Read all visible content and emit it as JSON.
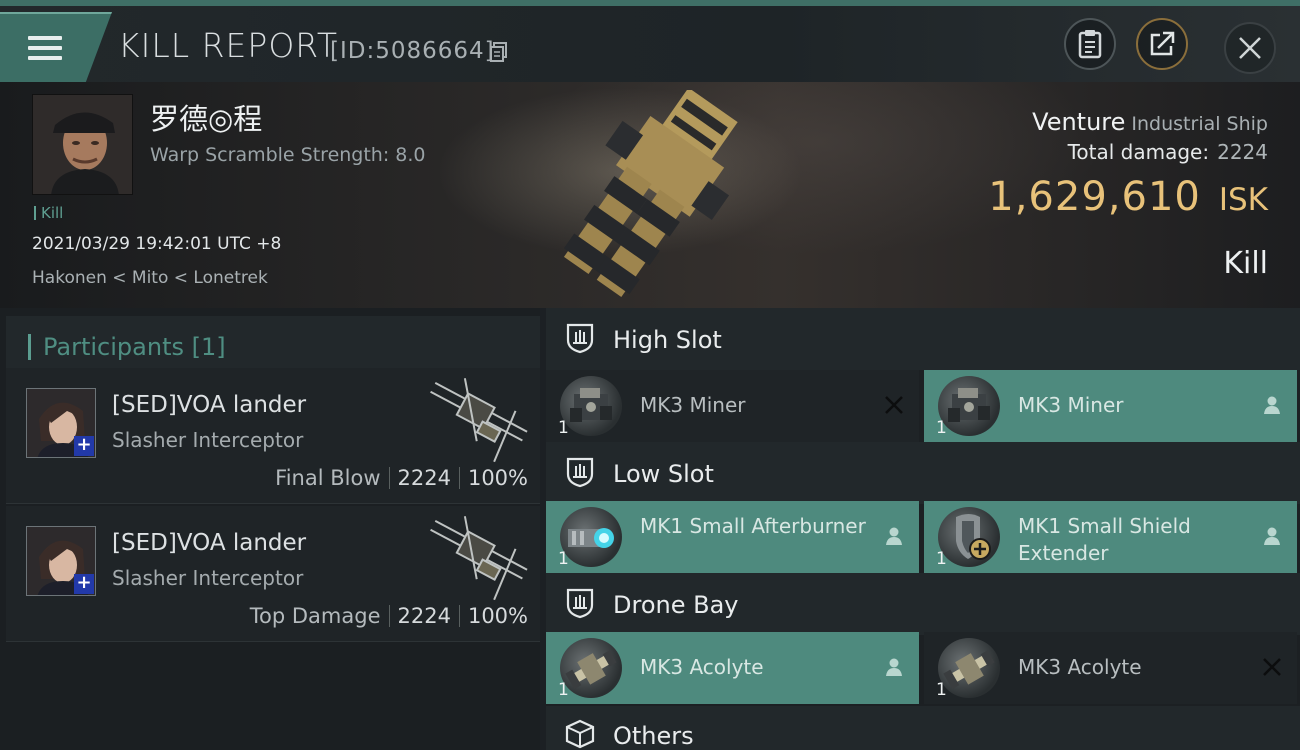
{
  "header": {
    "title": "KILL REPORT",
    "id_label": "[ID:5086664]"
  },
  "victim": {
    "name": "罗德◎程",
    "warp_scramble": "Warp Scramble Strength: 8.0",
    "tag": "Kill",
    "timestamp": "2021/03/29 19:42:01 UTC +8",
    "location": "Hakonen < Mito < Lonetrek"
  },
  "ship": {
    "name": "Venture",
    "class": "Industrial Ship",
    "total_damage_label": "Total damage:",
    "total_damage": "2224",
    "isk_value": "1,629,610",
    "isk_unit": "ISK",
    "result": "Kill"
  },
  "participants": {
    "title": "Participants [1]",
    "list": [
      {
        "name": "[SED]VOA lander",
        "ship": "Slasher Interceptor",
        "role": "Final Blow",
        "damage": "2224",
        "percent": "100%"
      },
      {
        "name": "[SED]VOA lander",
        "ship": "Slasher Interceptor",
        "role": "Top Damage",
        "damage": "2224",
        "percent": "100%"
      }
    ]
  },
  "fittings": {
    "high_slot": {
      "label": "High Slot",
      "modules": [
        {
          "name": "MK3 Miner",
          "qty": "1",
          "status": "destroyed"
        },
        {
          "name": "MK3 Miner",
          "qty": "1",
          "status": "dropped"
        }
      ]
    },
    "low_slot": {
      "label": "Low Slot",
      "modules": [
        {
          "name": "MK1 Small Afterburner",
          "qty": "1",
          "status": "dropped"
        },
        {
          "name": "MK1 Small Shield Extender",
          "qty": "1",
          "status": "dropped"
        }
      ]
    },
    "drone_bay": {
      "label": "Drone Bay",
      "modules": [
        {
          "name": "MK3  Acolyte",
          "qty": "1",
          "status": "dropped"
        },
        {
          "name": "MK3  Acolyte",
          "qty": "1",
          "status": "destroyed"
        }
      ]
    },
    "others": {
      "label": "Others"
    }
  },
  "colors": {
    "accent_teal": "#4e8a7e",
    "isk_gold": "#e8c27a",
    "header_bar": "#3c6e65"
  }
}
